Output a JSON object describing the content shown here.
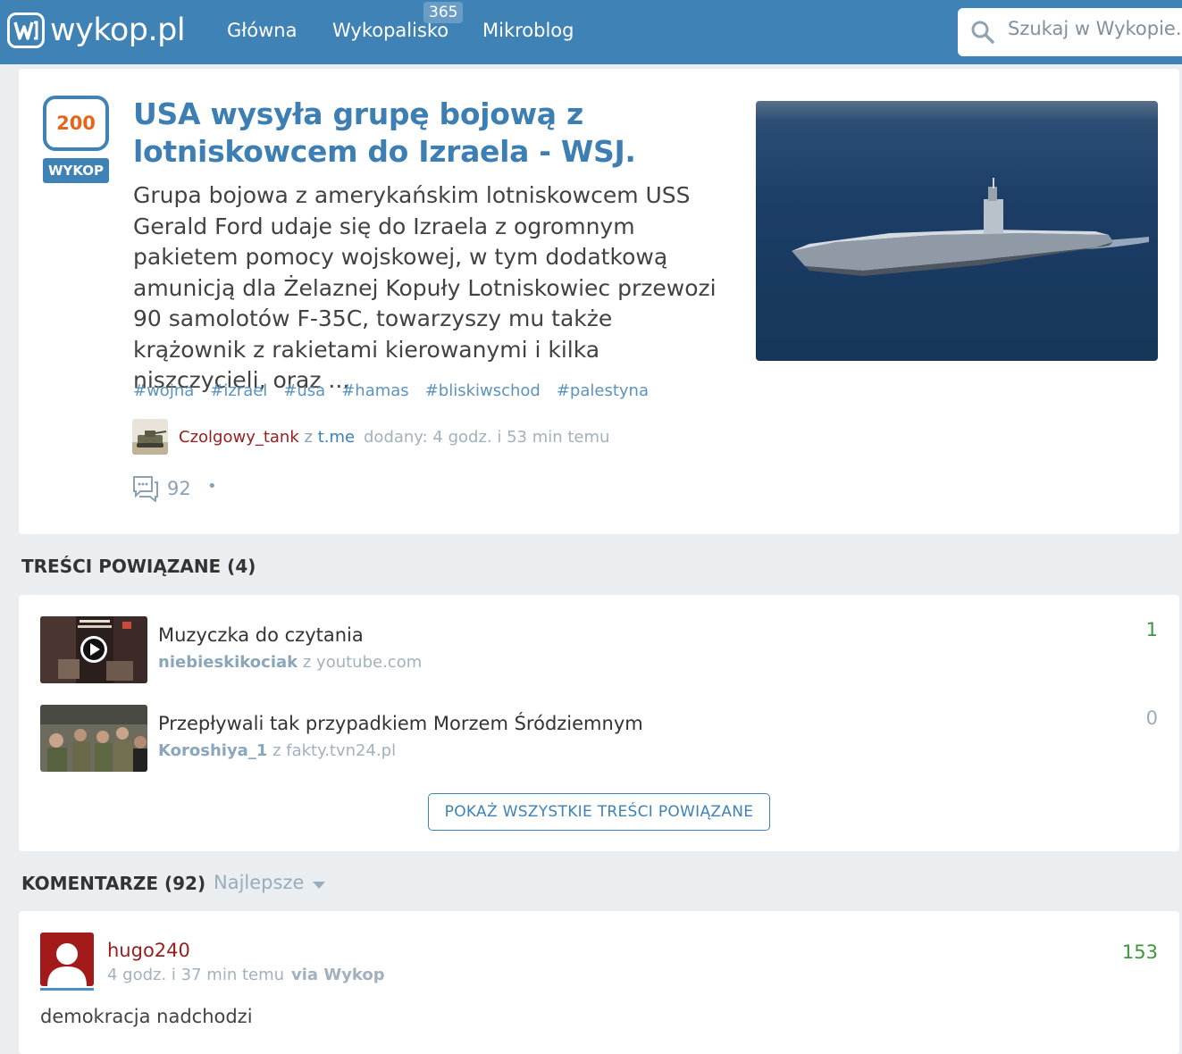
{
  "header": {
    "logo_text": "wykop.pl",
    "nav": [
      {
        "label": "Główna"
      },
      {
        "label": "Wykopalisko",
        "badge": "365"
      },
      {
        "label": "Mikroblog"
      }
    ],
    "search_placeholder": "Szukaj w Wykopie..."
  },
  "article": {
    "votes": "200",
    "vote_button": "WYKOP",
    "title": "USA wysyła grupę bojową z lotniskowcem do Izraela - WSJ.",
    "description": "Grupa bojowa z amerykańskim lotniskowcem USS Gerald Ford udaje się do Izraela z ogromnym pakietem pomocy wojskowej, w tym dodatkową amunicją dla Żelaznej Kopuły Lotniskowiec przewozi 90 samolotów F-35C, towarzyszy mu także krążownik z rakietami kierowanymi i kilka niszczycieli, oraz ...",
    "tags": [
      "#wojna",
      "#izrael",
      "#usa",
      "#hamas",
      "#bliskiwschod",
      "#palestyna"
    ],
    "author": "Czolgowy_tank",
    "from_word": "z",
    "source": "t.me",
    "added": "dodany: 4 godz. i 53 min temu",
    "comments_count": "92",
    "separator": "•"
  },
  "related": {
    "heading": "TREŚCI POWIĄZANE (4)",
    "items": [
      {
        "title": "Muzyczka do czytania",
        "author": "niebieskikociak",
        "from_word": "z",
        "source": "youtube.com",
        "score": "1",
        "score_color": "#3c963c"
      },
      {
        "title": "Przepływali tak przypadkiem Morzem Śródziemnym",
        "author": "Koroshiya_1",
        "from_word": "z",
        "source": "fakty.tvn24.pl",
        "score": "0",
        "score_color": "#98adbc"
      }
    ],
    "show_all": "POKAŻ WSZYSTKIE TREŚCI POWIĄZANE"
  },
  "comments": {
    "heading": "KOMENTARZE (92)",
    "sort_label": "Najlepsze",
    "items": [
      {
        "user": "hugo240",
        "time": "4 godz. i 37 min temu",
        "via": "via Wykop",
        "score": "153",
        "text": "demokracja nadchodzi"
      }
    ]
  },
  "colors": {
    "brand": "#3f82b5",
    "vote_count": "#e8641b",
    "author": "#9b1c1c",
    "positive": "#3c963c"
  }
}
